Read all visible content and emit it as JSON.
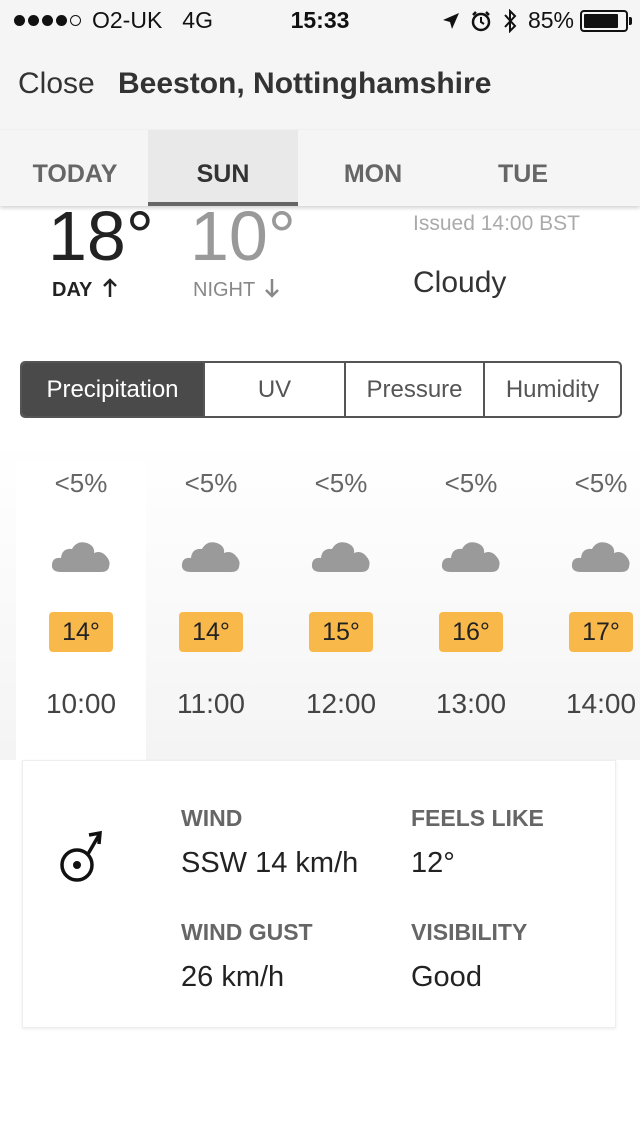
{
  "status_bar": {
    "carrier": "O2-UK",
    "network": "4G",
    "time": "15:33",
    "battery": "85%",
    "signal_bars_filled": 4,
    "signal_bars_total": 5
  },
  "header": {
    "close_label": "Close",
    "location": "Beeston, Nottinghamshire"
  },
  "tabs": [
    {
      "label": "TODAY",
      "active": false
    },
    {
      "label": "SUN",
      "active": true
    },
    {
      "label": "MON",
      "active": false
    },
    {
      "label": "TUE",
      "active": false
    }
  ],
  "summary": {
    "day_temp": "18°",
    "night_temp": "10°",
    "day_label": "DAY",
    "night_label": "NIGHT",
    "issued": "Issued 14:00 BST",
    "condition": "Cloudy"
  },
  "segments": [
    {
      "label": "Precipitation",
      "active": true
    },
    {
      "label": "UV",
      "active": false
    },
    {
      "label": "Pressure",
      "active": false
    },
    {
      "label": "Humidity",
      "active": false
    }
  ],
  "hourly": [
    {
      "precip": "<5%",
      "icon": "cloud-icon",
      "temp": "14°",
      "time": "10:00",
      "selected": true
    },
    {
      "precip": "<5%",
      "icon": "cloud-icon",
      "temp": "14°",
      "time": "11:00",
      "selected": false
    },
    {
      "precip": "<5%",
      "icon": "cloud-icon",
      "temp": "15°",
      "time": "12:00",
      "selected": false
    },
    {
      "precip": "<5%",
      "icon": "cloud-icon",
      "temp": "16°",
      "time": "13:00",
      "selected": false
    },
    {
      "precip": "<5%",
      "icon": "cloud-icon",
      "temp": "17°",
      "time": "14:00",
      "selected": false
    }
  ],
  "details": {
    "wind_label": "WIND",
    "wind_value": "SSW 14 km/h",
    "feels_like_label": "FEELS LIKE",
    "feels_like_value": "12°",
    "wind_gust_label": "WIND GUST",
    "wind_gust_value": "26 km/h",
    "visibility_label": "VISIBILITY",
    "visibility_value": "Good"
  },
  "colors": {
    "temp_badge": "#f8b94a",
    "segment_active": "#4a4a4a",
    "cloud": "#9a9a9a"
  }
}
